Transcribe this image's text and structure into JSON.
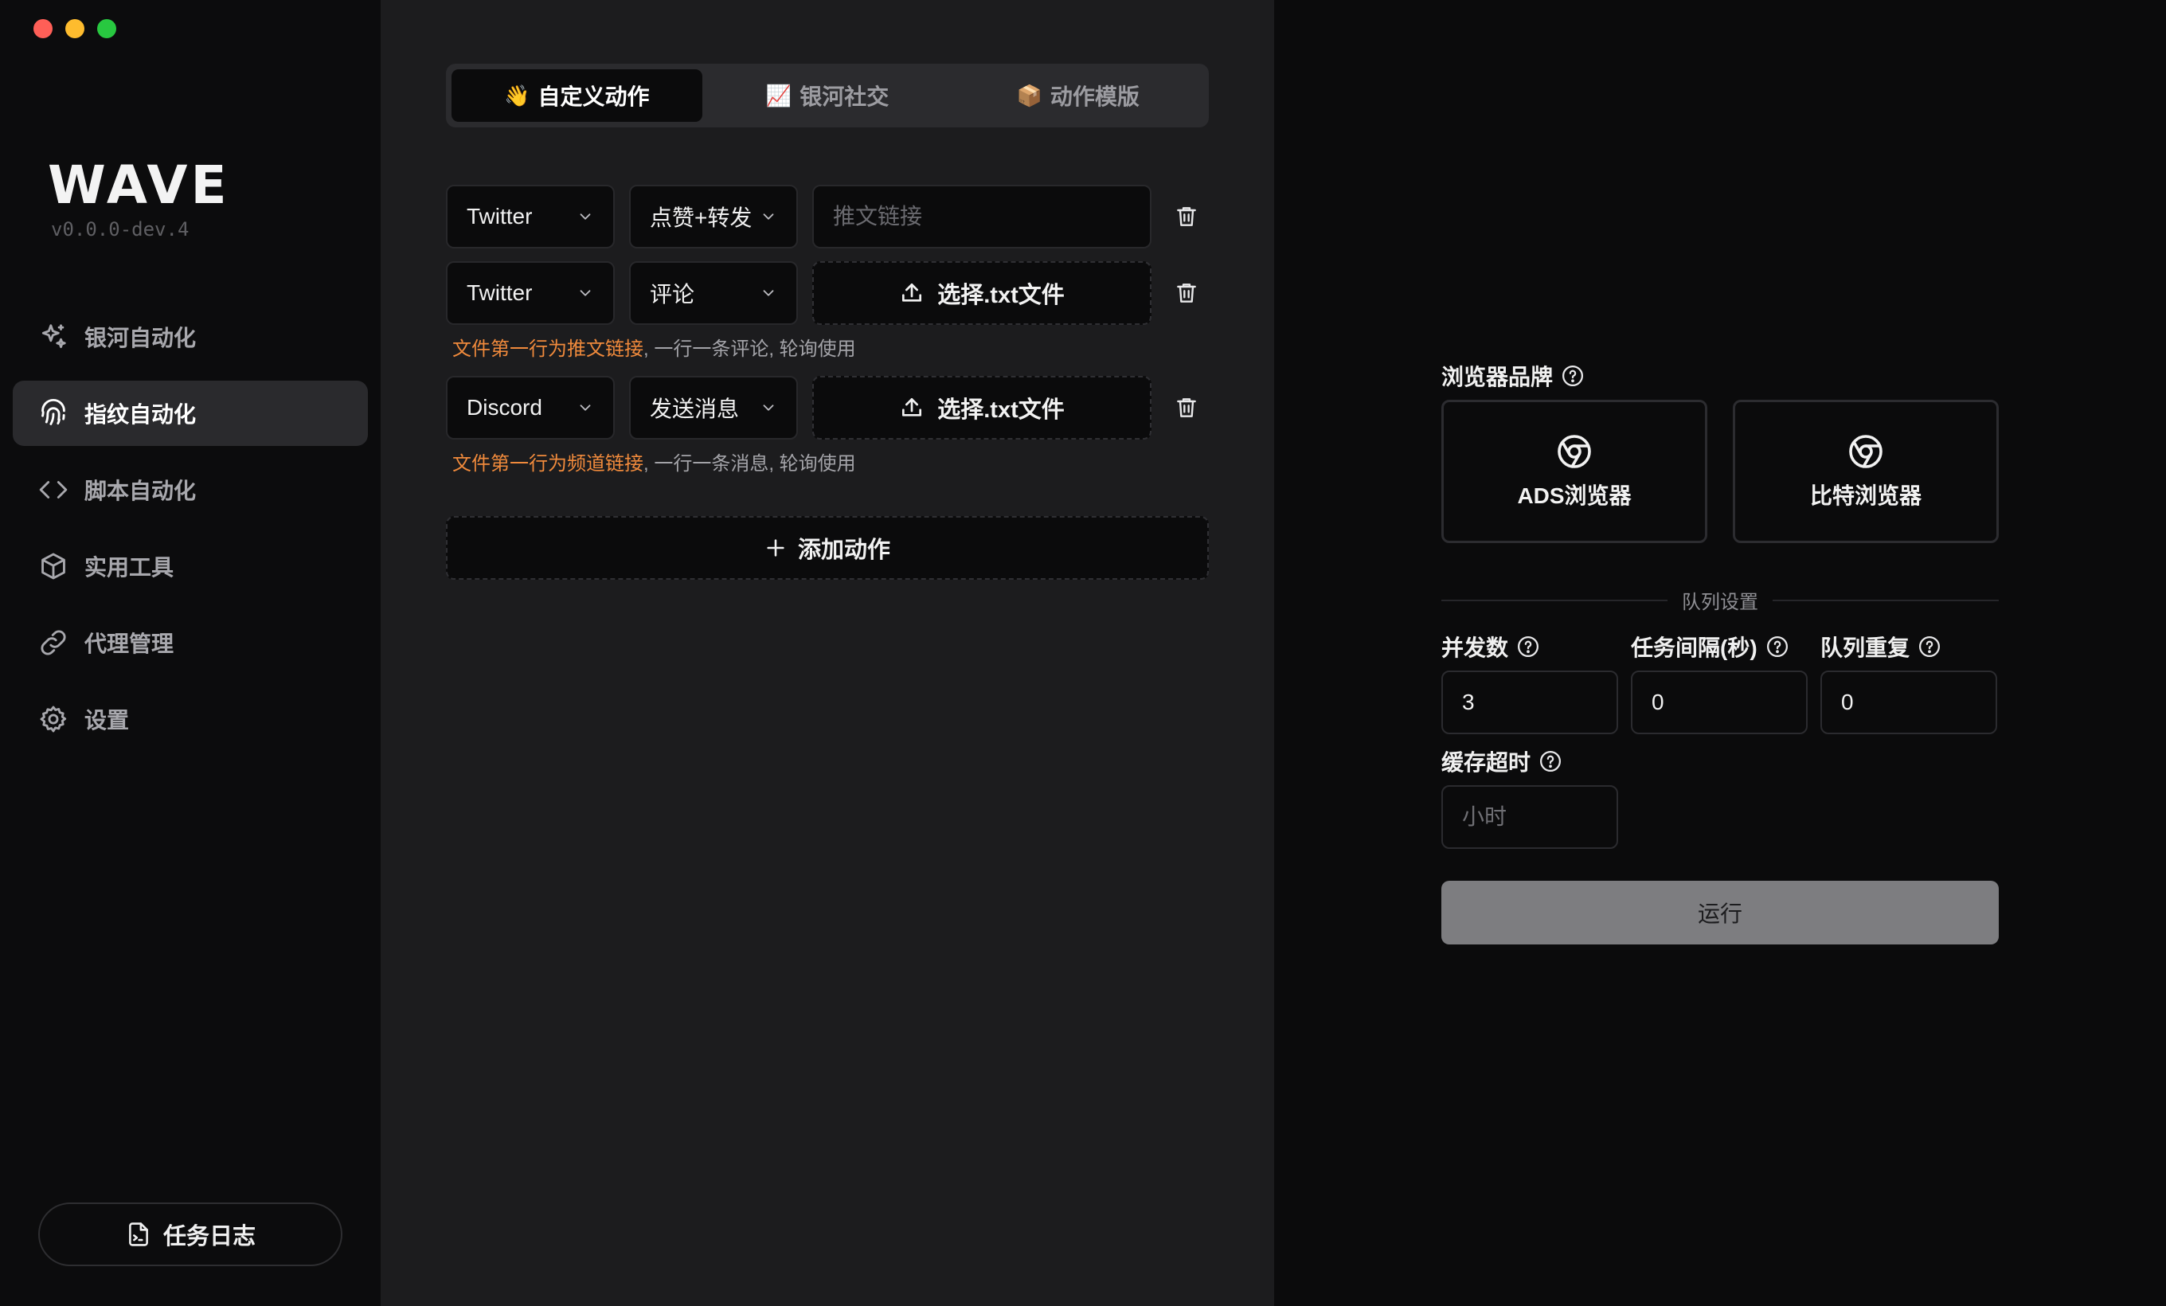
{
  "app": {
    "logo": "WAVE",
    "version": "v0.0.0-dev.4"
  },
  "sidebar": {
    "items": [
      {
        "label": "银河自动化",
        "icon": "sparkles-icon"
      },
      {
        "label": "指纹自动化",
        "icon": "fingerprint-icon",
        "active": true
      },
      {
        "label": "脚本自动化",
        "icon": "code-icon"
      },
      {
        "label": "实用工具",
        "icon": "box-icon"
      },
      {
        "label": "代理管理",
        "icon": "link-icon"
      },
      {
        "label": "设置",
        "icon": "gear-icon"
      }
    ],
    "log_button": "任务日志"
  },
  "tabs": [
    {
      "emoji": "👋",
      "label": "自定义动作",
      "active": true
    },
    {
      "emoji": "📈",
      "label": "银河社交"
    },
    {
      "emoji": "📦",
      "label": "动作模版"
    }
  ],
  "actions": [
    {
      "platform": "Twitter",
      "action": "点赞+转发",
      "input_placeholder": "推文链接"
    },
    {
      "platform": "Twitter",
      "action": "评论",
      "upload_label": "选择.txt文件",
      "hint_highlight": "文件第一行为推文链接",
      "hint_rest": ", 一行一条评论, 轮询使用"
    },
    {
      "platform": "Discord",
      "action": "发送消息",
      "upload_label": "选择.txt文件",
      "hint_highlight": "文件第一行为频道链接",
      "hint_rest": ", 一行一条消息, 轮询使用"
    }
  ],
  "add_action_label": "添加动作",
  "settings": {
    "browser_brand_label": "浏览器品牌",
    "browsers": [
      "ADS浏览器",
      "比特浏览器"
    ],
    "queue_divider": "队列设置",
    "concurrency_label": "并发数",
    "concurrency_value": "3",
    "interval_label": "任务间隔(秒)",
    "interval_value": "0",
    "repeat_label": "队列重复",
    "repeat_value": "0",
    "cache_timeout_label": "缓存超时",
    "cache_timeout_placeholder": "小时",
    "run_label": "运行"
  },
  "colors": {
    "hint_highlight": "#f08a3c",
    "run_button": "#7d7d80",
    "traffic_red": "#ff5f57",
    "traffic_yellow": "#febc2e",
    "traffic_green": "#28c840"
  }
}
